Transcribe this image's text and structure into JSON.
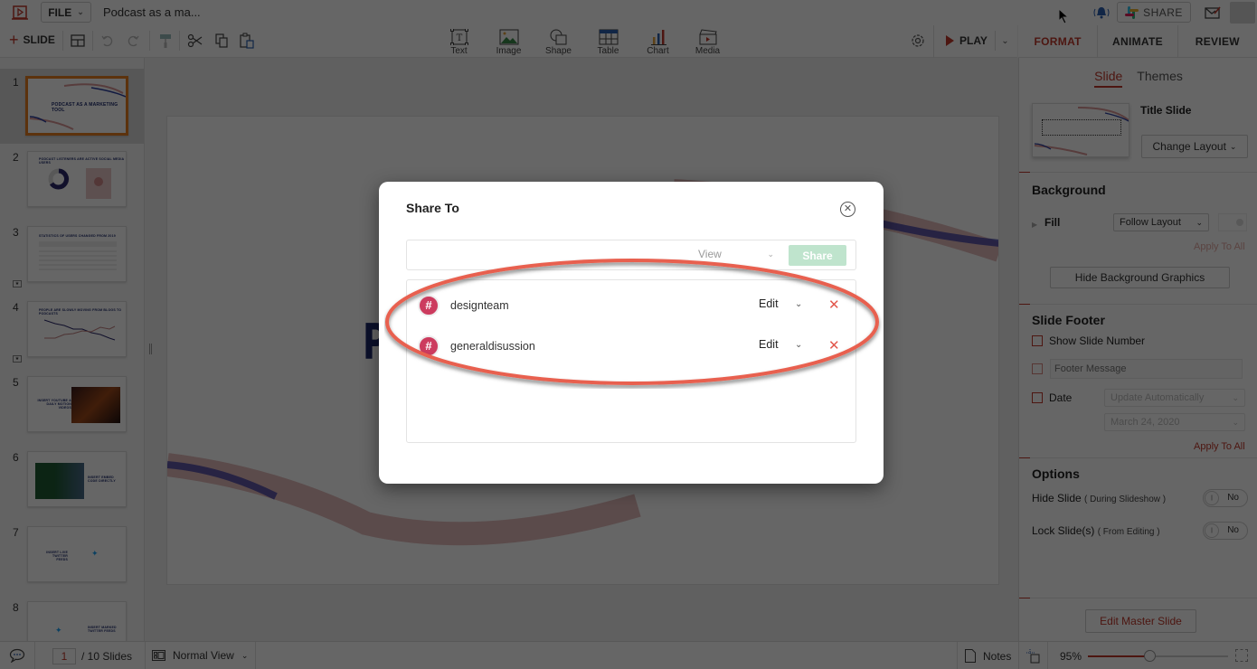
{
  "app": {
    "file_menu_label": "FILE",
    "document_title": "Podcast as a ma...",
    "share_button_label": "SHARE"
  },
  "toolbar": {
    "add_slide_label": "SLIDE",
    "insert_items": [
      {
        "label": "Text",
        "icon": "text-box-icon"
      },
      {
        "label": "Image",
        "icon": "image-icon"
      },
      {
        "label": "Shape",
        "icon": "shape-icon"
      },
      {
        "label": "Table",
        "icon": "table-icon"
      },
      {
        "label": "Chart",
        "icon": "chart-icon"
      },
      {
        "label": "Media",
        "icon": "media-icon"
      }
    ],
    "play_label": "PLAY"
  },
  "right_tabs": [
    {
      "label": "FORMAT",
      "active": true
    },
    {
      "label": "ANIMATE",
      "active": false
    },
    {
      "label": "REVIEW",
      "active": false
    }
  ],
  "slides_panel": {
    "slides": [
      {
        "number": "1",
        "title": "PODCAST AS A MARKETING TOOL",
        "selected": true
      },
      {
        "number": "2",
        "title": "PODCAST LISTENERS ARE ACTIVE SOCIAL MEDIA USERS",
        "selected": false
      },
      {
        "number": "3",
        "title": "STATISTICS OF USERS CHANGED FROM 2019",
        "selected": false,
        "has_animation": true
      },
      {
        "number": "4",
        "title": "PEOPLE ARE SLOWLY MOVING FROM BLOGS TO PODCASTS",
        "selected": false,
        "has_animation": true
      },
      {
        "number": "5",
        "title": "INSERT YOUTUBE & DAILY MOTION VIDEOS",
        "selected": false
      },
      {
        "number": "6",
        "title": "INSERT EMBED CODE DIRECTLY",
        "selected": false
      },
      {
        "number": "7",
        "title": "INSERT LIVE TWITTER FEEDS",
        "selected": false
      },
      {
        "number": "8",
        "title": "INSERT MARKED TWITTER FEEDS",
        "selected": false
      }
    ]
  },
  "canvas": {
    "visible_title_fragment": "P"
  },
  "format_panel": {
    "subtabs": [
      {
        "label": "Slide",
        "active": true
      },
      {
        "label": "Themes",
        "active": false
      }
    ],
    "layout_name": "Title Slide",
    "change_layout_label": "Change Layout",
    "background": {
      "title": "Background",
      "fill_label": "Fill",
      "fill_value": "Follow Layout",
      "apply_to_all_label": "Apply To All",
      "hide_bg_graphics_label": "Hide Background Graphics"
    },
    "footer": {
      "title": "Slide Footer",
      "show_slide_number_label": "Show Slide Number",
      "show_slide_number_checked": false,
      "footer_message_placeholder": "Footer Message",
      "date_label": "Date",
      "date_mode_value": "Update Automatically",
      "date_value": "March 24, 2020",
      "apply_to_all_label": "Apply To All"
    },
    "options": {
      "title": "Options",
      "hide_slide_label": "Hide Slide",
      "hide_slide_hint": "( During Slideshow )",
      "hide_slide_value": "No",
      "lock_slide_label": "Lock Slide(s)",
      "lock_slide_hint": "( From Editing )",
      "lock_slide_value": "No"
    },
    "edit_master_label": "Edit Master Slide"
  },
  "statusbar": {
    "current_page": "1",
    "total_pages_label": "/ 10 Slides",
    "view_mode": "Normal View",
    "notes_label": "Notes",
    "zoom_label": "95%",
    "zoom_fraction": 0.44
  },
  "share_dialog": {
    "title": "Share To",
    "input_placeholder": "",
    "permission_value": "View",
    "share_button_label": "Share",
    "recipients": [
      {
        "name": "designteam",
        "permission": "Edit",
        "type": "channel"
      },
      {
        "name": "generaldisussion",
        "permission": "Edit",
        "type": "channel"
      }
    ]
  },
  "colors": {
    "accent": "#c0392b",
    "share_btn_disabled": "#bfe4cd",
    "channel_avatar": "#cc3b5e",
    "annotation": "#e8604f"
  }
}
